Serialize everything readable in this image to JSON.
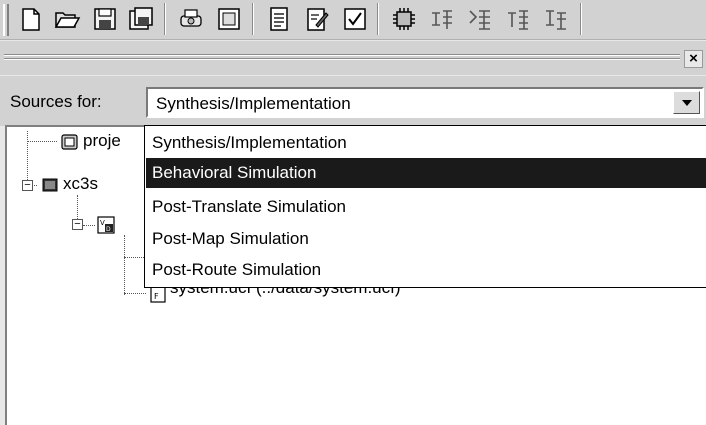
{
  "toolbar": {
    "buttons": [
      {
        "icon": "new-file-icon"
      },
      {
        "icon": "open-folder-icon"
      },
      {
        "icon": "save-icon"
      },
      {
        "icon": "save-all-icon"
      },
      {
        "icon": "print-icon"
      },
      {
        "icon": "print-preview-icon"
      },
      {
        "icon": "text-file-icon"
      },
      {
        "icon": "edit-file-icon"
      },
      {
        "icon": "checkbox-icon"
      },
      {
        "icon": "chip-settings-icon"
      },
      {
        "icon": "toggle-a-icon"
      },
      {
        "icon": "toggle-b-icon"
      },
      {
        "icon": "toggle-c-icon"
      },
      {
        "icon": "toggle-d-icon"
      }
    ]
  },
  "pane": {
    "close_label": "×"
  },
  "sources": {
    "label": "Sources for:",
    "selected_value": "Synthesis/Implementation",
    "options": [
      "Synthesis/Implementation",
      "Behavioral Simulation",
      "Post-Translate Simulation",
      "Post-Map Simulation",
      "Post-Route Simulation"
    ],
    "highlighted_index": 1
  },
  "tree": {
    "items": [
      {
        "label": "proje",
        "icon": "project-file-icon"
      },
      {
        "label": "xc3s",
        "icon": "chip-icon"
      },
      {
        "label": "",
        "icon": "vhdl-module-icon"
      },
      {
        "label": "system.ucf (../data/system.ucf)",
        "icon": "ucf-file-icon"
      }
    ]
  }
}
